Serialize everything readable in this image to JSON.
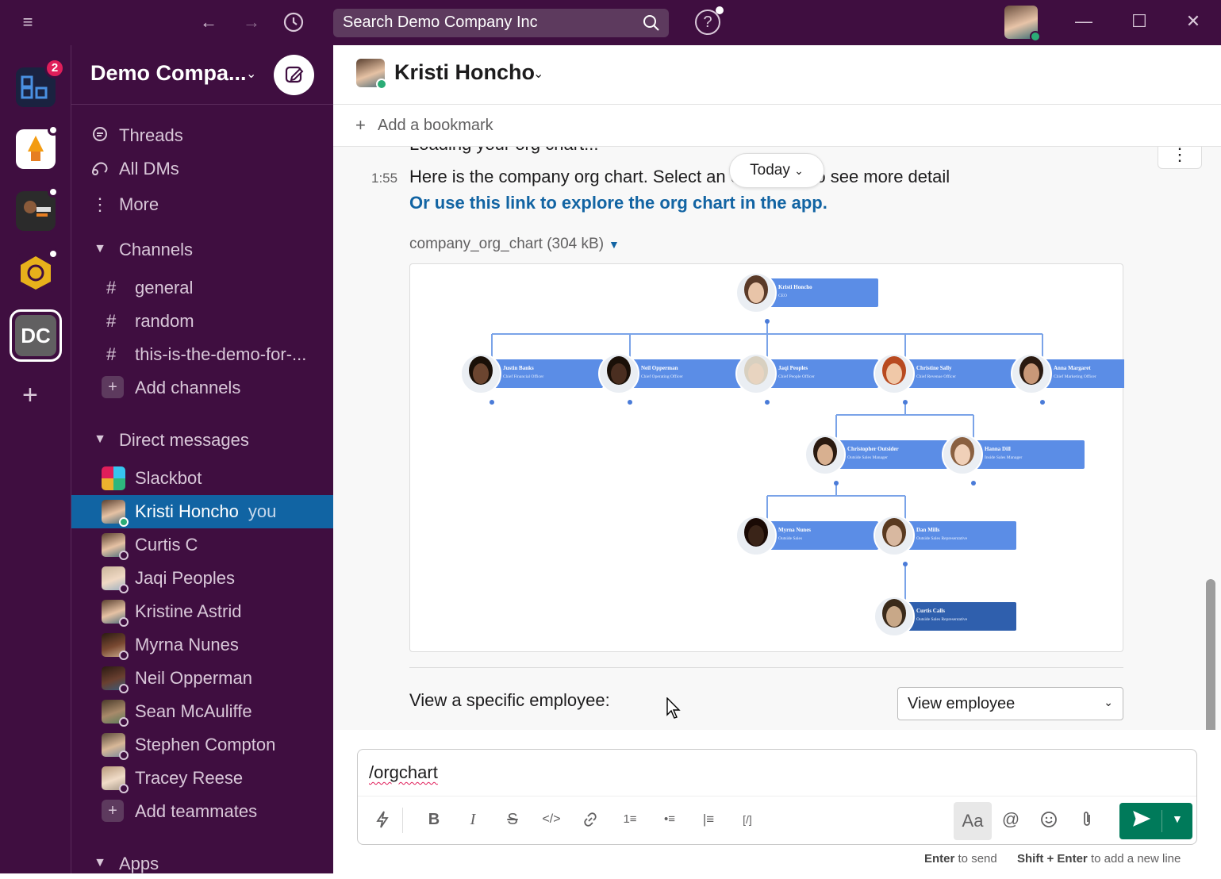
{
  "titlebar": {
    "search_placeholder": "Search Demo Company Inc",
    "menu_icon": "hamburger-icon",
    "back_icon": "arrow-left-icon",
    "forward_icon": "arrow-right-icon",
    "history_icon": "clock-icon"
  },
  "rail": {
    "badge_count": "2",
    "active_workspace": "DC"
  },
  "sidebar": {
    "workspace_name": "Demo Compa...",
    "nav": [
      {
        "label": "Threads"
      },
      {
        "label": "All DMs"
      },
      {
        "label": "More"
      }
    ],
    "channels_header": "Channels",
    "channels": [
      {
        "name": "general"
      },
      {
        "name": "random"
      },
      {
        "name": "this-is-the-demo-for-..."
      }
    ],
    "add_channels": "Add channels",
    "dm_header": "Direct messages",
    "dms": [
      {
        "name": "Slackbot"
      },
      {
        "name": "Kristi Honcho",
        "suffix": "you"
      },
      {
        "name": "Curtis C"
      },
      {
        "name": "Jaqi Peoples"
      },
      {
        "name": "Kristine Astrid"
      },
      {
        "name": "Myrna Nunes"
      },
      {
        "name": "Neil Opperman"
      },
      {
        "name": "Sean McAuliffe"
      },
      {
        "name": "Stephen Compton"
      },
      {
        "name": "Tracey Reese"
      }
    ],
    "add_teammates": "Add teammates",
    "apps_header": "Apps"
  },
  "channel": {
    "name": "Kristi Honcho",
    "add_bookmark": "Add a bookmark"
  },
  "message": {
    "cut_text": "Loading your org chart...",
    "today": "Today",
    "time": "1:55",
    "text": "Here is the company org chart. Select an employee to see more detail",
    "link": "Or use this link to explore the org chart in the app.",
    "file_name": "company_org_chart (304 kB)",
    "view_label": "View a specific employee:",
    "view_select": "View employee"
  },
  "orgchart": {
    "nodes": [
      {
        "name": "Kristi Honcho",
        "title": "CEO"
      },
      {
        "name": "Justin Banks",
        "title": "Chief Financial Officer"
      },
      {
        "name": "Neil Opperman",
        "title": "Chief Operating Officer"
      },
      {
        "name": "Jaqi Peoples",
        "title": "Chief People Officer"
      },
      {
        "name": "Christine Sally",
        "title": "Chief Revenue Officer"
      },
      {
        "name": "Anna Margaret",
        "title": "Chief Marketing Officer"
      },
      {
        "name": "Christopher Outsider",
        "title": "Outside Sales Manager"
      },
      {
        "name": "Hanna Dill",
        "title": "Inside Sales Manager"
      },
      {
        "name": "Myrna Nunes",
        "title": "Outside Sales"
      },
      {
        "name": "Dan Mills",
        "title": "Outside Sales Representative"
      },
      {
        "name": "Curtis Calls",
        "title": "Outside Sales Representative"
      }
    ]
  },
  "composer": {
    "value": "/orgchart",
    "format_aa": "Aa",
    "hint_send_key": "Enter",
    "hint_send_text": "to send",
    "hint_newline_key": "Shift + Enter",
    "hint_newline_text": "to add a new line"
  }
}
